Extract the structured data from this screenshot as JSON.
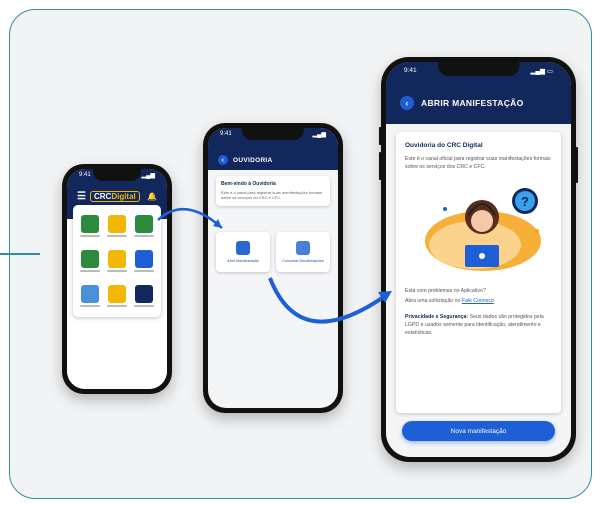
{
  "phone1": {
    "status_time": "9:41",
    "logo_text": "CRC",
    "logo_digital": "Digital",
    "tile_colors": [
      "#2b8a3e",
      "#f2b705",
      "#2b8a3e",
      "#2b8a3e",
      "#f2b705",
      "#1e5fd8",
      "#4a90d9",
      "#f2b705",
      "#12285c"
    ]
  },
  "phone2": {
    "status_time": "9:41",
    "title": "OUVIDORIA",
    "welcome_title": "Bem-vindo à Ouvidoria",
    "welcome_text": "Este é o canal para registrar suas manifestações formais sobre os serviços do CRC e CFC.",
    "option1": "Abrir Manifestação",
    "option2": "Consultar Manifestações"
  },
  "phone3": {
    "status_time": "9:41",
    "title": "ABRIR MANIFESTAÇÃO",
    "heading": "Ouvidoria do CRC Digital",
    "intro": "Este é o canal oficial para registrar suas manifestações formais sobre os serviços dos CRC e CFC.",
    "problem_line1": "Está com problemas no Aplicativo?",
    "problem_line2": "Abra uma solicitação no",
    "problem_link": "Fale Conosco",
    "privacy_label": "Privacidade e Segurança:",
    "privacy_text": "Seus dados são protegidos pela LGPD e usados somente para identificação, atendimento e estatísticas.",
    "button": "Nova manifestação"
  },
  "colors": {
    "navy": "#12285c",
    "accent_blue": "#1e5fd8",
    "frame_teal": "#2f8f9d",
    "gold": "#f2b705"
  }
}
